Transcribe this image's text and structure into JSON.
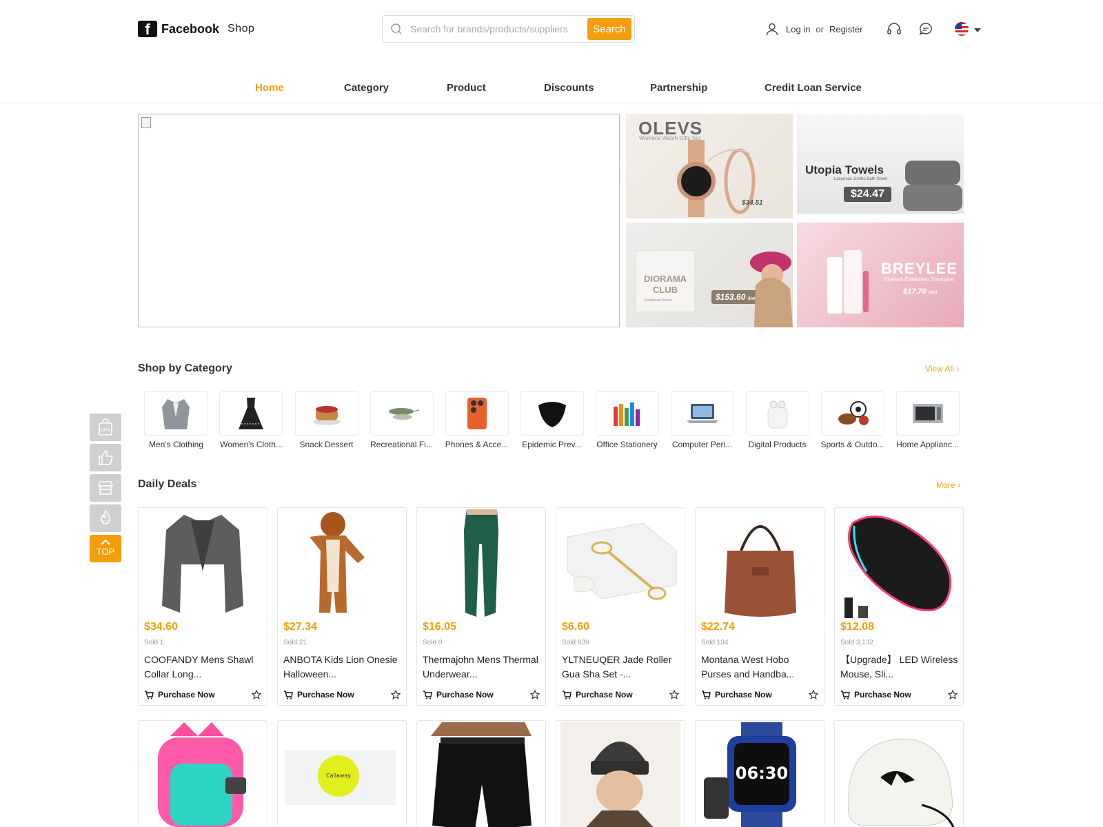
{
  "header": {
    "logo_mark": "f",
    "logo_text": "Facebook",
    "logo_sub": "Shop",
    "search_placeholder": "Search for brands/products/suppliers",
    "search_button": "Search",
    "login": "Log in",
    "or": "or",
    "register": "Register"
  },
  "nav": [
    "Home",
    "Category",
    "Product",
    "Discounts",
    "Partnership",
    "Credit Loan Service"
  ],
  "banners": {
    "olevs": {
      "title": "OLEVS",
      "sub": "Womens Watch Gifts Set",
      "price": "$34.51"
    },
    "utopia": {
      "title": "Utopia Towels",
      "sub": "Luxurious Jumbo Bath Sheet",
      "price": "$24.47"
    },
    "diorama": {
      "title": "DIORAMA CLUB",
      "sub": "Sunglasses Brand",
      "price": "$153.60",
      "unit": "/unit"
    },
    "breylee": {
      "title": "BREYLEE",
      "sub": "Eyelash Extension Shampoo",
      "price": "$17.70",
      "unit": "/unit"
    }
  },
  "category_section": {
    "title": "Shop by Category",
    "view_all": "View All",
    "items": [
      "Men's Clothing",
      "Women's Cloth...",
      "Snack Dessert",
      "Recreational Fi...",
      "Phones & Acce...",
      "Epidemic Prev...",
      "Office Stationery",
      "Computer Peri...",
      "Digital Products",
      "Sports & Outdo...",
      "Home Applianc..."
    ]
  },
  "deals_section": {
    "title": "Daily Deals",
    "more": "More",
    "purchase_label": "Purchase Now",
    "products": [
      {
        "price": "$34.60",
        "sold": "Sold 1",
        "name": "COOFANDY Mens Shawl Collar Long..."
      },
      {
        "price": "$27.34",
        "sold": "Sold 21",
        "name": "ANBOTA Kids Lion Onesie Halloween..."
      },
      {
        "price": "$16.05",
        "sold": "Sold 0",
        "name": "Thermajohn Mens Thermal Underwear..."
      },
      {
        "price": "$6.60",
        "sold": "Sold 839",
        "name": "YLTNEUQER Jade Roller Gua Sha Set -..."
      },
      {
        "price": "$22.74",
        "sold": "Sold 134",
        "name": "Montana West Hobo Purses and Handba..."
      },
      {
        "price": "$12.08",
        "sold": "Sold 3,132",
        "name": "【Upgrade】 LED Wireless Mouse, Sli..."
      }
    ]
  },
  "side_bar": {
    "top_label": "TOP"
  },
  "colors": {
    "accent": "#f59e0b",
    "text": "#222222",
    "border": "#e6e6e6"
  }
}
